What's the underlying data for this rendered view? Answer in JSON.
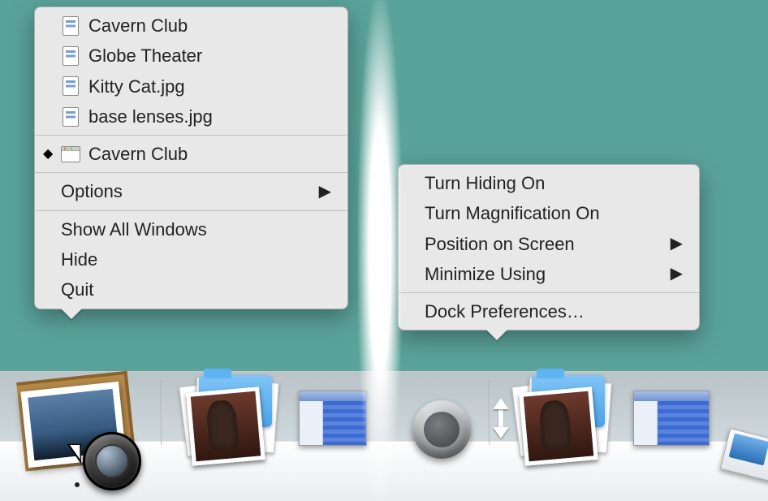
{
  "menus": {
    "app": {
      "recent": [
        {
          "label": "Cavern Club"
        },
        {
          "label": "Globe Theater"
        },
        {
          "label": "Kitty Cat.jpg"
        },
        {
          "label": "base lenses.jpg"
        }
      ],
      "windows": [
        {
          "label": "Cavern Club"
        }
      ],
      "options_label": "Options",
      "show_all_label": "Show All Windows",
      "hide_label": "Hide",
      "quit_label": "Quit"
    },
    "dock": {
      "hiding_label": "Turn Hiding On",
      "magnification_label": "Turn Magnification On",
      "position_label": "Position on Screen",
      "minimize_label": "Minimize Using",
      "prefs_label": "Dock Preferences…"
    }
  }
}
